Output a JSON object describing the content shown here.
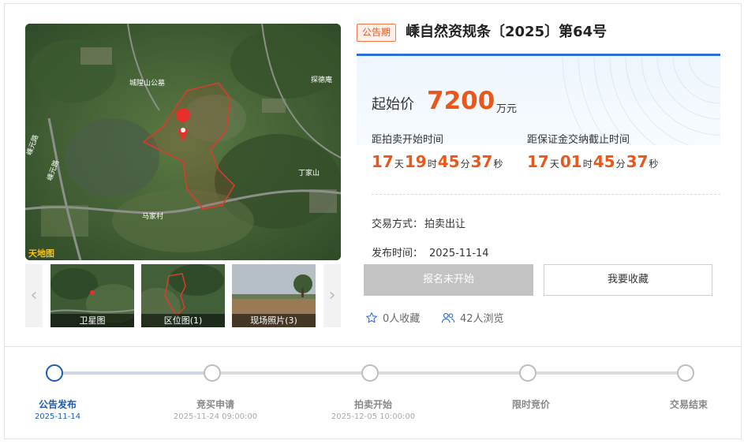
{
  "listing": {
    "badge": "公告期",
    "title": "嵊自然资规条〔2025〕第64号"
  },
  "gallery": {
    "watermark": "天地图",
    "thumbnails": [
      {
        "caption": "卫星图"
      },
      {
        "caption": "区位图(1)"
      },
      {
        "caption": "现场照片(3)"
      }
    ]
  },
  "price": {
    "label": "起始价",
    "value": "7200",
    "unit": "万元"
  },
  "countdowns": [
    {
      "label": "距拍卖开始时间",
      "days": "17",
      "hours": "19",
      "minutes": "45",
      "seconds": "37"
    },
    {
      "label": "距保证金交纳截止时间",
      "days": "17",
      "hours": "01",
      "minutes": "45",
      "seconds": "37"
    }
  ],
  "units": {
    "day": "天",
    "hour": "时",
    "minute": "分",
    "second": "秒"
  },
  "details": {
    "trade_method_label": "交易方式：",
    "trade_method": "拍卖出让",
    "publish_time_label": "发布时间：",
    "publish_time": "2025-11-14"
  },
  "actions": {
    "register_label": "报名未开始",
    "collect_label": "我要收藏"
  },
  "stats": {
    "favorites": "0人收藏",
    "views": "42人浏览"
  },
  "map_labels": {
    "l1": "城隍山公墓",
    "l2": "探德庵",
    "l3": "丁家山",
    "l4": "马家村",
    "l5": "嵊元路",
    "l6": "嵊元路"
  },
  "progress": [
    {
      "name": "公告发布",
      "date": "2025-11-14"
    },
    {
      "name": "竞买申请",
      "date": "2025-11-24 09:00:00"
    },
    {
      "name": "拍卖开始",
      "date": "2025-12-05 10:00:00"
    },
    {
      "name": "限时竞价",
      "date": ""
    },
    {
      "name": "交易结束",
      "date": ""
    }
  ],
  "colors": {
    "accent": "#e8581a",
    "brand_blue": "#1f5cae"
  }
}
